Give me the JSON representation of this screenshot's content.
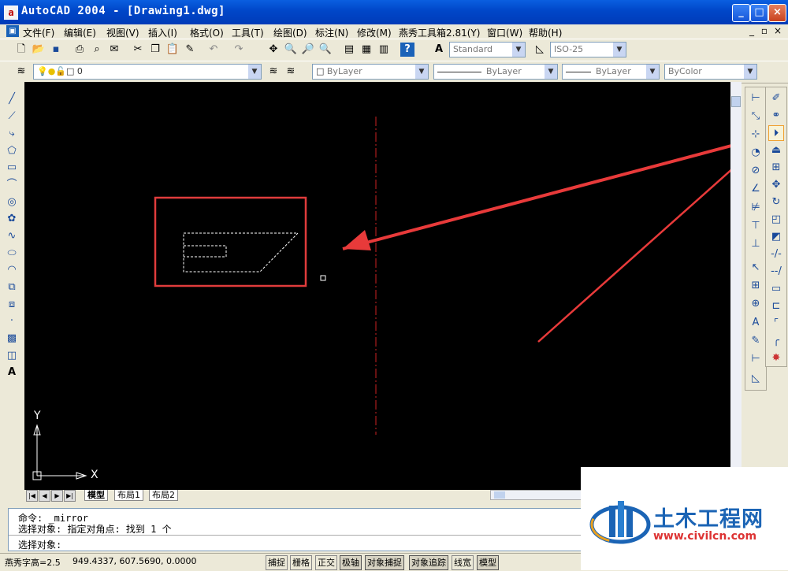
{
  "window": {
    "app_icon": "a",
    "title": "AutoCAD 2004 - [Drawing1.dwg]",
    "controls": [
      "minimize-icon",
      "maximize-icon",
      "close-icon"
    ]
  },
  "menu": {
    "items": [
      "文件(F)",
      "编辑(E)",
      "视图(V)",
      "插入(I)",
      "格式(O)",
      "工具(T)",
      "绘图(D)",
      "标注(N)",
      "修改(M)",
      "燕秀工具箱2.81(Y)",
      "窗口(W)",
      "帮助(H)"
    ],
    "doc_controls": [
      "_",
      "▫",
      "×"
    ]
  },
  "style_toolbar": {
    "text_style": "Standard",
    "dim_style": "ISO-25"
  },
  "layer_toolbar": {
    "layer": "0",
    "color": "ByLayer",
    "linetype": "ByLayer",
    "lineweight": "ByLayer",
    "plotstyle": "ByColor"
  },
  "drawing": {
    "ucs_y": "Y",
    "ucs_x": "X",
    "colors": {
      "background": "#000000",
      "mirror_line": "#cc2222",
      "highlight": "#e03c3c",
      "selected": "#ffffff"
    }
  },
  "layout_tabs": [
    "模型",
    "布局1",
    "布局2"
  ],
  "command": {
    "history": [
      "命令: _mirror",
      "选择对象: 指定对角点: 找到 1 个"
    ],
    "prompt": "选择对象:"
  },
  "status": {
    "text": "燕秀字高=2.5",
    "coords": "949.4337,   607.5690,  0.0000",
    "buttons": [
      "捕捉",
      "栅格",
      "正交",
      "极轴",
      "对象捕捉",
      "对象追踪",
      "线宽",
      "模型"
    ]
  },
  "watermark": {
    "name": "土木工程网",
    "url": "www.civilcn.com"
  }
}
